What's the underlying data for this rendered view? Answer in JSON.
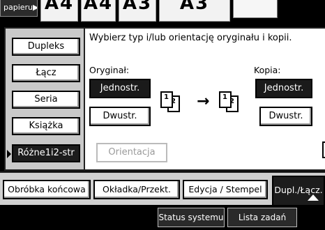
{
  "top": {
    "paper_tab": "papieru▶",
    "size_buttons": [
      "A4",
      "A4",
      "A3"
    ]
  },
  "panel": {
    "modes": [
      "Dupleks",
      "Łącz",
      "Seria",
      "Książka",
      "Różne1i2-str"
    ],
    "active_mode": "Dupleks",
    "instruction": "Wybierz typ i/lub orientację oryginału i kopii.",
    "original": {
      "label": "Oryginał:",
      "one_sided": "Jednostr.",
      "two_sided": "Dwustr.",
      "selected": "Jednostr."
    },
    "copy": {
      "label": "Kopia:",
      "one_sided": "Jednostr.",
      "two_sided": "Dwustr.",
      "selected": "Jednostr."
    },
    "orientation": "Orientacja",
    "page_icons": {
      "p1": "1",
      "p2": "2"
    },
    "arrow": "→"
  },
  "tabs": [
    "Obróbka końcowa",
    "Okładka/Przekt.",
    "Edycja / Stempel",
    "Dupl./Łącz."
  ],
  "active_tab": "Dupl./Łącz.",
  "status": {
    "system": "Status systemu",
    "jobs": "Lista zadań"
  }
}
